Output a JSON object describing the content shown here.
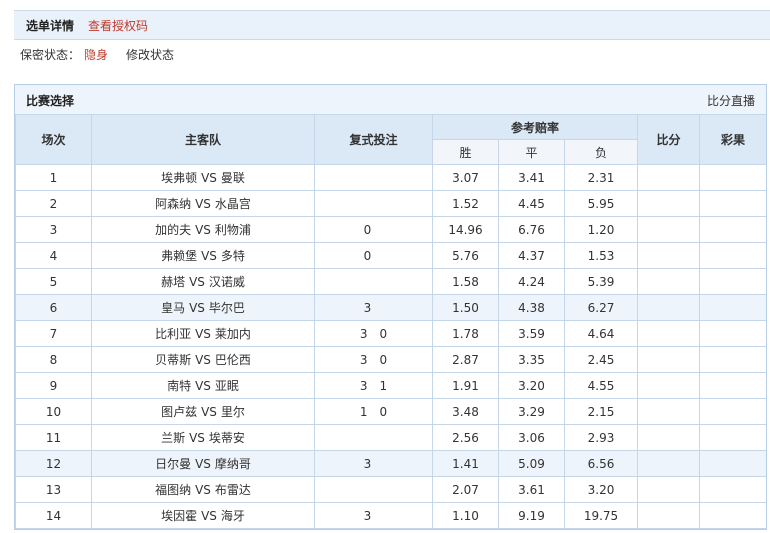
{
  "top": {
    "active_tab": "选单详情",
    "link_tab": "查看授权码"
  },
  "status": {
    "label": "保密状态：",
    "value": "隐身",
    "modify": "修改状态"
  },
  "panel": {
    "title": "比赛选择",
    "live": "比分直播"
  },
  "table": {
    "headers": {
      "no": "场次",
      "teams": "主客队",
      "multi_bet": "复式投注",
      "odds": "参考赔率",
      "win": "胜",
      "draw": "平",
      "lose": "负",
      "score": "比分",
      "result": "彩果"
    },
    "vs": "VS",
    "rows": [
      {
        "no": "1",
        "home": "埃弗顿",
        "away": "曼联",
        "b1": "",
        "b2": "",
        "win": "3.07",
        "draw": "3.41",
        "lose": "2.31",
        "score": "",
        "result": ""
      },
      {
        "no": "2",
        "home": "阿森纳",
        "away": "水晶宫",
        "b1": "",
        "b2": "",
        "win": "1.52",
        "draw": "4.45",
        "lose": "5.95",
        "score": "",
        "result": ""
      },
      {
        "no": "3",
        "home": "加的夫",
        "away": "利物浦",
        "b1": "0",
        "b2": "",
        "win": "14.96",
        "draw": "6.76",
        "lose": "1.20",
        "score": "",
        "result": ""
      },
      {
        "no": "4",
        "home": "弗赖堡",
        "away": "多特",
        "b1": "0",
        "b2": "",
        "win": "5.76",
        "draw": "4.37",
        "lose": "1.53",
        "score": "",
        "result": ""
      },
      {
        "no": "5",
        "home": "赫塔",
        "away": "汉诺威",
        "b1": "",
        "b2": "",
        "win": "1.58",
        "draw": "4.24",
        "lose": "5.39",
        "score": "",
        "result": ""
      },
      {
        "no": "6",
        "home": "皇马",
        "away": "毕尔巴",
        "b1": "3",
        "b2": "",
        "win": "1.50",
        "draw": "4.38",
        "lose": "6.27",
        "score": "",
        "result": ""
      },
      {
        "no": "7",
        "home": "比利亚",
        "away": "莱加内",
        "b1": "3",
        "b2": "0",
        "win": "1.78",
        "draw": "3.59",
        "lose": "4.64",
        "score": "",
        "result": ""
      },
      {
        "no": "8",
        "home": "贝蒂斯",
        "away": "巴伦西",
        "b1": "3",
        "b2": "0",
        "win": "2.87",
        "draw": "3.35",
        "lose": "2.45",
        "score": "",
        "result": ""
      },
      {
        "no": "9",
        "home": "南特",
        "away": "亚眠",
        "b1": "3",
        "b2": "1",
        "win": "1.91",
        "draw": "3.20",
        "lose": "4.55",
        "score": "",
        "result": ""
      },
      {
        "no": "10",
        "home": "图卢兹",
        "away": "里尔",
        "b1": "1",
        "b2": "0",
        "win": "3.48",
        "draw": "3.29",
        "lose": "2.15",
        "score": "",
        "result": ""
      },
      {
        "no": "11",
        "home": "兰斯",
        "away": "埃蒂安",
        "b1": "",
        "b2": "",
        "win": "2.56",
        "draw": "3.06",
        "lose": "2.93",
        "score": "",
        "result": ""
      },
      {
        "no": "12",
        "home": "日尔曼",
        "away": "摩纳哥",
        "b1": "3",
        "b2": "",
        "win": "1.41",
        "draw": "5.09",
        "lose": "6.56",
        "score": "",
        "result": ""
      },
      {
        "no": "13",
        "home": "福图纳",
        "away": "布雷达",
        "b1": "",
        "b2": "",
        "win": "2.07",
        "draw": "3.61",
        "lose": "3.20",
        "score": "",
        "result": ""
      },
      {
        "no": "14",
        "home": "埃因霍",
        "away": "海牙",
        "b1": "3",
        "b2": "",
        "win": "1.10",
        "draw": "9.19",
        "lose": "19.75",
        "score": "",
        "result": ""
      }
    ]
  },
  "colors": {
    "accent_red": "#c0392b",
    "team_red": "#b03030",
    "header_bg": "#dbe8f5",
    "highlight_row": "#eef4fb",
    "border_blue": "#c5d6e8"
  }
}
